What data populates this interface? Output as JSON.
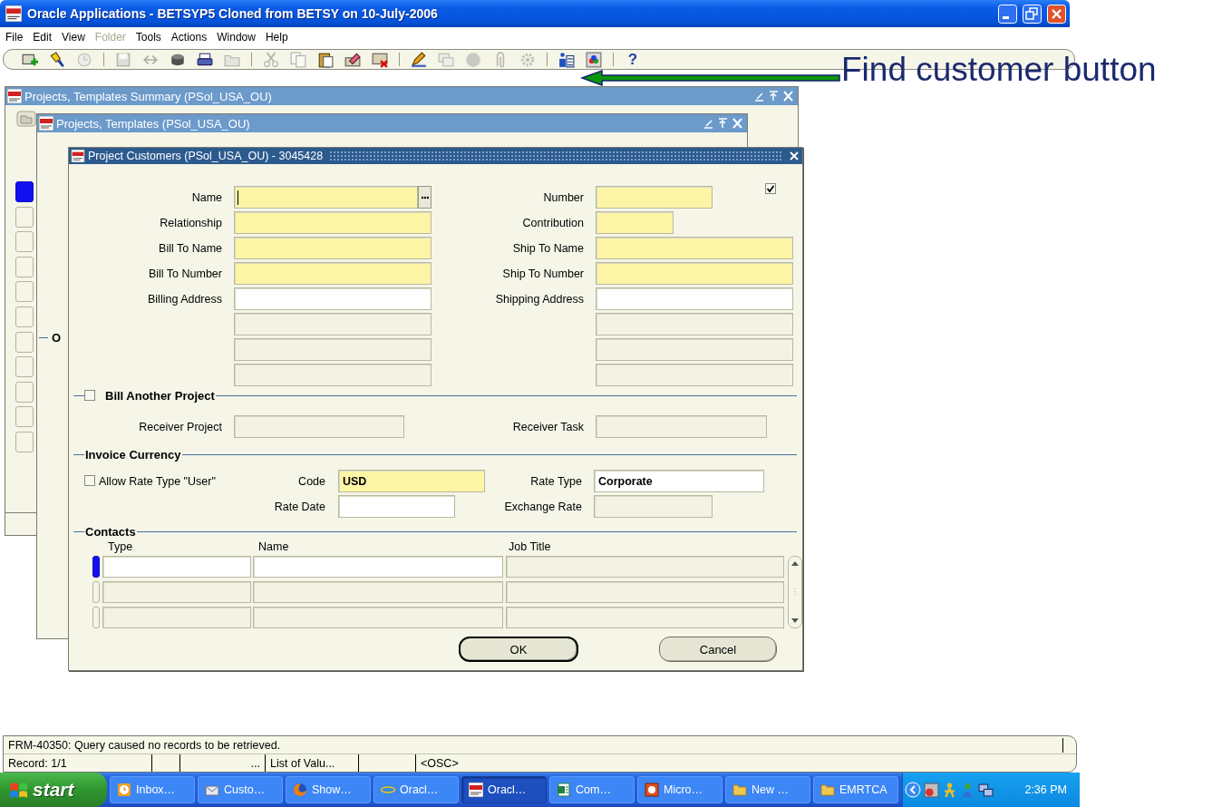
{
  "window": {
    "title": "Oracle Applications - BETSYP5 Cloned from BETSY on 10-July-2006"
  },
  "menu": [
    {
      "label": "File",
      "disabled": false
    },
    {
      "label": "Edit",
      "disabled": false
    },
    {
      "label": "View",
      "disabled": false
    },
    {
      "label": "Folder",
      "disabled": true
    },
    {
      "label": "Tools",
      "disabled": false
    },
    {
      "label": "Actions",
      "disabled": false
    },
    {
      "label": "Window",
      "disabled": false
    },
    {
      "label": "Help",
      "disabled": false
    }
  ],
  "toolbar": [
    {
      "kind": "new",
      "disabled": false
    },
    {
      "kind": "flashlight",
      "disabled": false
    },
    {
      "kind": "clock",
      "disabled": true
    },
    {
      "kind": "separator"
    },
    {
      "kind": "disk",
      "disabled": true
    },
    {
      "kind": "arrows",
      "disabled": true
    },
    {
      "kind": "cylinder",
      "disabled": false
    },
    {
      "kind": "printer",
      "disabled": false
    },
    {
      "kind": "folder",
      "disabled": true
    },
    {
      "kind": "separator"
    },
    {
      "kind": "scissors",
      "disabled": true
    },
    {
      "kind": "copy",
      "disabled": true
    },
    {
      "kind": "paste",
      "disabled": false
    },
    {
      "kind": "eraser",
      "disabled": false
    },
    {
      "kind": "delete",
      "disabled": false
    },
    {
      "kind": "separator"
    },
    {
      "kind": "pencil",
      "disabled": false
    },
    {
      "kind": "windows",
      "disabled": true
    },
    {
      "kind": "sphere",
      "disabled": true
    },
    {
      "kind": "clip",
      "disabled": true
    },
    {
      "kind": "gear",
      "disabled": true
    },
    {
      "kind": "separator"
    },
    {
      "kind": "person",
      "disabled": false
    },
    {
      "kind": "palette",
      "disabled": false
    },
    {
      "kind": "separator"
    },
    {
      "kind": "help",
      "label": "?",
      "disabled": false
    }
  ],
  "windows": [
    {
      "title": "Projects, Templates Summary (PSol_USA_OU)",
      "records": [
        {
          "selected": true
        },
        {
          "selected": false
        },
        {
          "selected": false
        },
        {
          "selected": false
        },
        {
          "selected": false
        },
        {
          "selected": false
        },
        {
          "selected": false
        },
        {
          "selected": false
        },
        {
          "selected": false
        },
        {
          "selected": false
        },
        {
          "selected": false
        }
      ]
    },
    {
      "title": "Projects, Templates (PSol_USA_OU)",
      "section_label": "O"
    }
  ],
  "dialog": {
    "title": "Project Customers (PSol_USA_OU) - 3045428",
    "flag": {
      "checked": true
    },
    "rows": [
      {
        "left": {
          "label": "Name",
          "kind": "required",
          "lov": true,
          "focused": true
        },
        "right": {
          "label": "Number",
          "kind": "required",
          "focused": false
        }
      },
      {
        "left": {
          "label": "Relationship",
          "kind": "required",
          "focused": false
        },
        "right": {
          "label": "Contribution",
          "kind": "required",
          "focused": false
        }
      },
      {
        "left": {
          "label": "Bill To Name",
          "kind": "required",
          "focused": false
        },
        "right": {
          "label": "Ship To Name",
          "kind": "required",
          "focused": false
        }
      },
      {
        "left": {
          "label": "Bill To Number",
          "kind": "required",
          "focused": false
        },
        "right": {
          "label": "Ship To Number",
          "kind": "required",
          "focused": false
        }
      },
      {
        "left": {
          "label": "Billing Address",
          "kind": "optional",
          "focused": false
        },
        "right": {
          "label": "Shipping Address",
          "kind": "optional",
          "focused": false
        }
      },
      {
        "left": {
          "kind": "readonly",
          "focused": false
        },
        "right": {
          "kind": "readonly",
          "focused": false
        }
      },
      {
        "left": {
          "kind": "readonly",
          "focused": false
        },
        "right": {
          "kind": "readonly",
          "focused": false
        }
      },
      {
        "left": {
          "kind": "readonly",
          "focused": false
        },
        "right": {
          "kind": "readonly",
          "focused": false
        }
      }
    ],
    "bill_another_project": {
      "label": "Bill Another Project",
      "checked": false,
      "receiver_project": {
        "label": "Receiver Project",
        "kind": "readonly"
      },
      "receiver_task": {
        "label": "Receiver Task",
        "kind": "readonly"
      }
    },
    "invoice_currency": {
      "label": "Invoice Currency",
      "allow_rate_type": {
        "label": "Allow Rate Type \"User\"",
        "checked": false
      },
      "code": {
        "label": "Code",
        "kind": "required",
        "value": "USD"
      },
      "rate_type": {
        "label": "Rate Type",
        "kind": "optional",
        "value": "Corporate"
      },
      "rate_date": {
        "label": "Rate Date",
        "kind": "optional"
      },
      "exchange_rate": {
        "label": "Exchange Rate",
        "kind": "readonly"
      }
    },
    "contacts": {
      "label": "Contacts",
      "columns": [
        "Type",
        "Name",
        "Job Title"
      ],
      "rows": [
        {
          "selected": true,
          "cells": [
            {
              "kind": "optional"
            },
            {
              "kind": "optional"
            },
            {
              "kind": "readonly"
            }
          ]
        },
        {
          "selected": false,
          "cells": [
            {
              "kind": "readonly"
            },
            {
              "kind": "readonly"
            },
            {
              "kind": "readonly"
            }
          ]
        },
        {
          "selected": false,
          "cells": [
            {
              "kind": "readonly"
            },
            {
              "kind": "readonly"
            },
            {
              "kind": "readonly"
            }
          ]
        }
      ]
    },
    "buttons": [
      {
        "label": "OK",
        "default": true
      },
      {
        "label": "Cancel",
        "default": false
      }
    ]
  },
  "status": {
    "message": "FRM-40350: Query caused no records to be retrieved.",
    "record": "Record: 1/1",
    "segments": [
      "...",
      "List of Valu...",
      "<OSC>"
    ]
  },
  "taskbar": {
    "start": "start",
    "items": [
      {
        "label": "Inbox…",
        "kind": "outlook",
        "selected": false
      },
      {
        "label": "Custo…",
        "kind": "envelope",
        "selected": false
      },
      {
        "label": "Show…",
        "kind": "firefox",
        "selected": false
      },
      {
        "label": "Oracl…",
        "kind": "ie",
        "selected": false
      },
      {
        "label": "Oracl…",
        "kind": "oracle",
        "selected": true
      },
      {
        "label": "Com…",
        "kind": "excel",
        "selected": false
      },
      {
        "label": "Micro…",
        "kind": "powerpoint",
        "selected": false
      },
      {
        "label": "New …",
        "kind": "folder",
        "selected": false
      },
      {
        "label": "EMRTCA",
        "kind": "folder",
        "selected": false
      }
    ],
    "clock": "2:36 PM"
  },
  "annotation": {
    "text": "Find customer button"
  }
}
